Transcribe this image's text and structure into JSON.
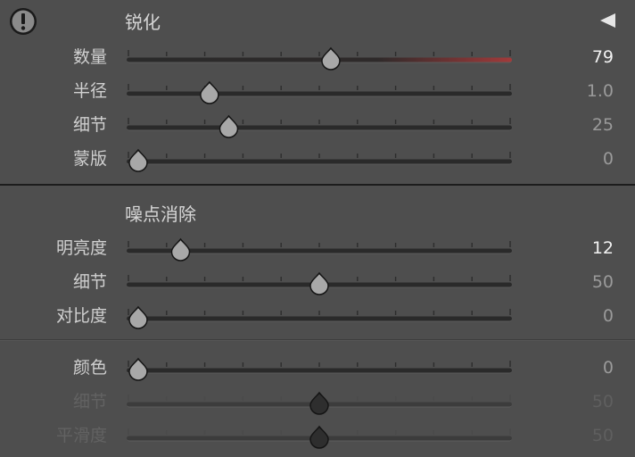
{
  "sharpening": {
    "title": "锐化",
    "icons": {
      "warning": "warning-icon",
      "collapse": "collapse-triangle-icon"
    },
    "sliders": [
      {
        "id": "amount",
        "label": "数量",
        "value": "79",
        "position": 0.53,
        "active_value": true,
        "track": "red-tint"
      },
      {
        "id": "radius",
        "label": "半径",
        "value": "1.0",
        "position": 0.215,
        "active_value": false
      },
      {
        "id": "detail",
        "label": "细节",
        "value": "25",
        "position": 0.265,
        "active_value": false
      },
      {
        "id": "masking",
        "label": "蒙版",
        "value": "0",
        "position": 0.03,
        "active_value": false
      }
    ]
  },
  "noise_reduction": {
    "title": "噪点消除",
    "luminance_sliders": [
      {
        "id": "luminance",
        "label": "明亮度",
        "value": "12",
        "position": 0.14,
        "active_value": true
      },
      {
        "id": "lum-detail",
        "label": "细节",
        "value": "50",
        "position": 0.5,
        "active_value": false
      },
      {
        "id": "lum-contrast",
        "label": "对比度",
        "value": "0",
        "position": 0.03,
        "active_value": false
      }
    ],
    "color_sliders": [
      {
        "id": "color",
        "label": "颜色",
        "value": "0",
        "position": 0.03,
        "active_value": false,
        "disabled": false
      },
      {
        "id": "color-detail",
        "label": "细节",
        "value": "50",
        "position": 0.5,
        "active_value": false,
        "disabled": true
      },
      {
        "id": "smoothness",
        "label": "平滑度",
        "value": "50",
        "position": 0.5,
        "active_value": false,
        "disabled": true
      }
    ]
  },
  "colors": {
    "panel_bg": "#4e4e4e",
    "track": "#2a2a2a",
    "thumb": "#a8a8a8",
    "thumb_disabled": "#2e2e2e",
    "accent_red": "#a23a3a"
  }
}
